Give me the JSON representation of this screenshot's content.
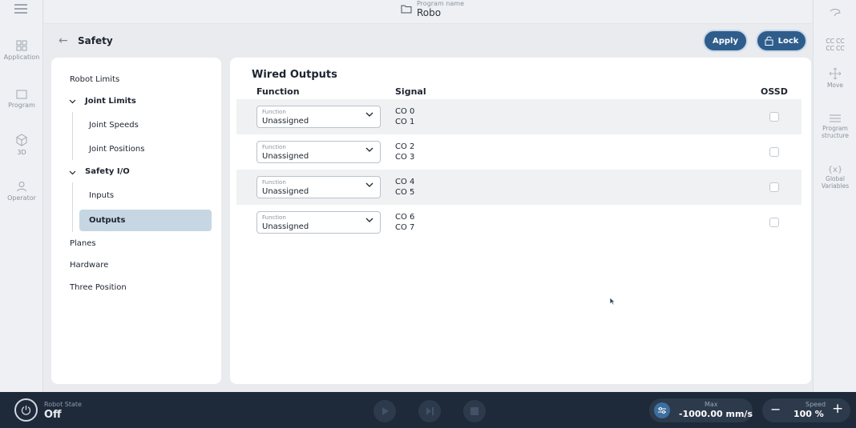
{
  "topbar": {
    "program_label": "Program name",
    "program_name": "Robo"
  },
  "left_rail": [
    {
      "label": "Application",
      "icon": "application-grid-icon"
    },
    {
      "label": "Program",
      "icon": "program-icon"
    },
    {
      "label": "3D",
      "icon": "cube-icon"
    },
    {
      "label": "Operator",
      "icon": "operator-icon"
    }
  ],
  "right_rail": [
    {
      "label": "",
      "icon": "hand-icon"
    },
    {
      "label": "CC CC\nCC CC",
      "icon": "cc-icon"
    },
    {
      "label": "Move",
      "icon": "move-icon"
    },
    {
      "label": "Program structure",
      "icon": "structure-icon"
    },
    {
      "label": "Global Variables",
      "icon": "variables-icon"
    }
  ],
  "header": {
    "title": "Safety",
    "apply_label": "Apply",
    "lock_label": "Lock"
  },
  "nav": {
    "robot_limits": "Robot Limits",
    "joint_limits": "Joint Limits",
    "joint_speeds": "Joint Speeds",
    "joint_positions": "Joint Positions",
    "safety_io": "Safety I/O",
    "inputs": "Inputs",
    "outputs": "Outputs",
    "planes": "Planes",
    "hardware": "Hardware",
    "three_position": "Three Position"
  },
  "main": {
    "title": "Wired Outputs",
    "col_function": "Function",
    "col_signal": "Signal",
    "col_ossd": "OSSD",
    "rows": [
      {
        "function_label": "Function",
        "function_value": "Unassigned",
        "signal_a": "CO 0",
        "signal_b": "CO 1",
        "ossd": false
      },
      {
        "function_label": "Function",
        "function_value": "Unassigned",
        "signal_a": "CO 2",
        "signal_b": "CO 3",
        "ossd": false
      },
      {
        "function_label": "Function",
        "function_value": "Unassigned",
        "signal_a": "CO 4",
        "signal_b": "CO 5",
        "ossd": false
      },
      {
        "function_label": "Function",
        "function_value": "Unassigned",
        "signal_a": "CO 6",
        "signal_b": "CO 7",
        "ossd": false
      }
    ]
  },
  "bottom": {
    "robot_state_label": "Robot State",
    "robot_state_value": "Off",
    "max_label": "Max",
    "max_value": "-1000.00 mm/s",
    "speed_label": "Speed",
    "speed_value": "100 %"
  },
  "colors": {
    "accent": "#2e5d8c",
    "selected_nav": "#c6d6e3",
    "bottom_bar": "#1e2a3a"
  }
}
